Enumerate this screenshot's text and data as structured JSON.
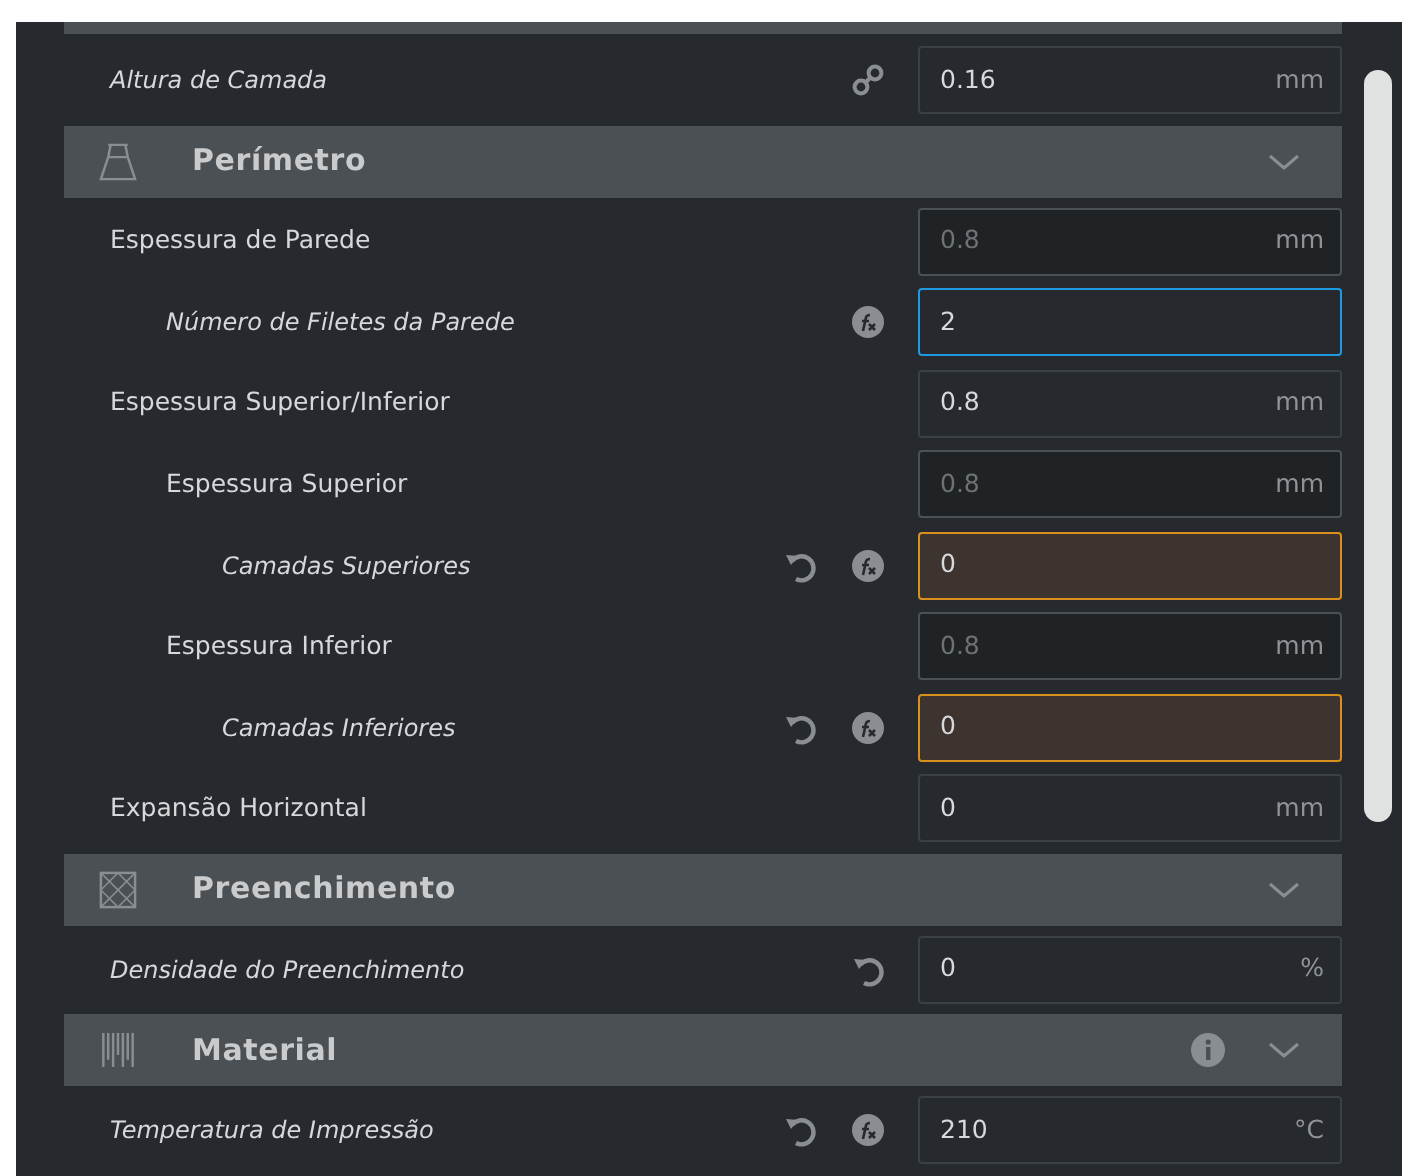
{
  "settings": [
    {
      "kind": "setting",
      "label": "Altura de Camada",
      "italic": true,
      "linked": true,
      "reset": false,
      "function": false,
      "value": "0.16",
      "unit": "mm",
      "disabled": false,
      "focused": false,
      "warning": false
    },
    {
      "kind": "section",
      "title": "Perímetro",
      "info": false,
      "expanded": true
    },
    {
      "kind": "setting",
      "label": "Espessura de Parede",
      "italic": false,
      "linked": false,
      "reset": false,
      "function": false,
      "value": "0.8",
      "unit": "mm",
      "disabled": true,
      "focused": false,
      "warning": false,
      "children": [
        {
          "kind": "setting",
          "label": "Número de Filetes da Parede",
          "italic": true,
          "linked": false,
          "reset": false,
          "function": true,
          "value": "2",
          "disabled": false,
          "focused": true,
          "warning": false
        }
      ]
    },
    {
      "kind": "setting",
      "label": "Espessura Superior/Inferior",
      "italic": false,
      "linked": false,
      "reset": false,
      "function": false,
      "value": "0.8",
      "unit": "mm",
      "disabled": false,
      "focused": false,
      "warning": false,
      "children": [
        {
          "kind": "setting",
          "label": "Espessura Superior",
          "italic": false,
          "linked": false,
          "reset": false,
          "function": false,
          "value": "0.8",
          "unit": "mm",
          "disabled": true,
          "focused": false,
          "warning": false,
          "children": [
            {
              "kind": "setting",
              "label": "Camadas Superiores",
              "italic": true,
              "linked": false,
              "reset": true,
              "function": true,
              "value": "0",
              "disabled": false,
              "focused": false,
              "warning": true
            }
          ]
        },
        {
          "kind": "setting",
          "label": "Espessura Inferior",
          "italic": false,
          "linked": false,
          "reset": false,
          "function": false,
          "value": "0.8",
          "unit": "mm",
          "disabled": true,
          "focused": false,
          "warning": false,
          "children": [
            {
              "kind": "setting",
              "label": "Camadas Inferiores",
              "italic": true,
              "linked": false,
              "reset": true,
              "function": true,
              "value": "0",
              "disabled": false,
              "focused": false,
              "warning": true
            }
          ]
        }
      ]
    },
    {
      "kind": "setting",
      "label": "Expansão Horizontal",
      "italic": false,
      "linked": false,
      "reset": false,
      "function": false,
      "value": "0",
      "unit": "mm",
      "disabled": false,
      "focused": false,
      "warning": false
    },
    {
      "kind": "section",
      "title": "Preenchimento",
      "info": false,
      "expanded": true
    },
    {
      "kind": "setting",
      "label": "Densidade do Preenchimento",
      "italic": true,
      "linked": false,
      "reset": true,
      "function": false,
      "value": "0",
      "unit": "%",
      "disabled": false,
      "focused": false,
      "warning": false
    },
    {
      "kind": "section",
      "title": "Material",
      "info": true,
      "expanded": true
    },
    {
      "kind": "setting",
      "label": "Temperatura de Impressão",
      "italic": true,
      "linked": false,
      "reset": true,
      "function": true,
      "value": "210",
      "unit": "°C",
      "disabled": false,
      "focused": false,
      "warning": false
    }
  ]
}
